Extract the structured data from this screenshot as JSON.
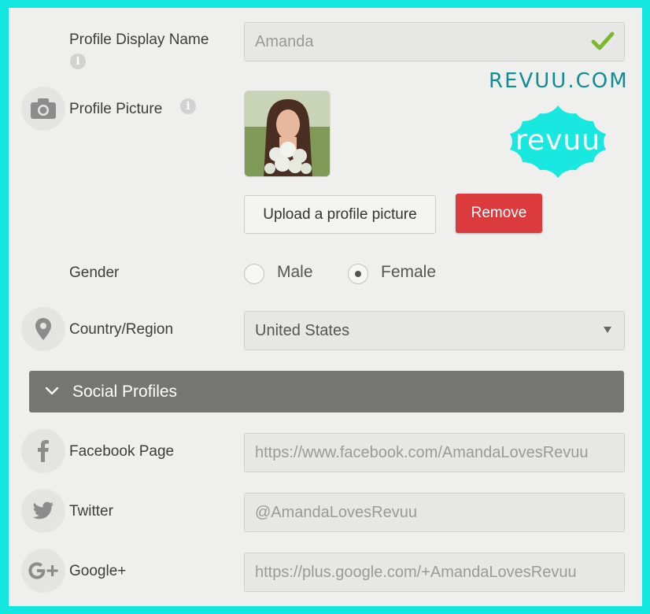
{
  "profile": {
    "display_name_label": "Profile Display Name",
    "display_name_value": "Amanda",
    "picture_label": "Profile Picture",
    "upload_button": "Upload a profile picture",
    "remove_button": "Remove"
  },
  "gender": {
    "label": "Gender",
    "options": [
      "Male",
      "Female"
    ],
    "selected": "Female"
  },
  "country": {
    "label": "Country/Region",
    "value": "United States"
  },
  "social": {
    "section_title": "Social Profiles",
    "facebook_label": "Facebook Page",
    "facebook_value": "https://www.facebook.com/AmandaLovesRevuu",
    "twitter_label": "Twitter",
    "twitter_value": "@AmandaLovesRevuu",
    "google_label": "Google+",
    "google_value": "https://plus.google.com/+AmandaLovesRevuu"
  },
  "branding": {
    "site": "REVUU.COM",
    "badge": "revuu"
  },
  "icons": [
    "info-icon",
    "camera-icon",
    "location-pin-icon",
    "facebook-icon",
    "twitter-icon",
    "google-plus-icon",
    "checkmark-icon",
    "chevron-down-icon"
  ],
  "colors": {
    "frame": "#13e6df",
    "remove_button": "#dc3b3e",
    "section_bar": "#757574",
    "checkmark": "#7cb82f",
    "brand_text": "#0e8e93",
    "brand_badge": "#18e8e0"
  }
}
